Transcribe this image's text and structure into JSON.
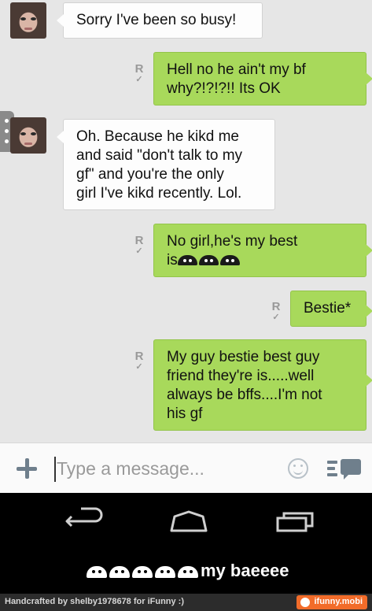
{
  "conversation": {
    "messages": [
      {
        "direction": "incoming",
        "text": "Sorry I've been so busy!"
      },
      {
        "direction": "outgoing",
        "read_mark": "R",
        "lines": [
          "Hell no he ain't my bf",
          "why?!?!?!! Its OK"
        ]
      },
      {
        "direction": "incoming",
        "lines": [
          "Oh. Because he kikd me",
          "and said \"don't talk to my",
          "gf\" and you're the only",
          "girl I've kikd recently. Lol."
        ]
      },
      {
        "direction": "outgoing",
        "read_mark": "R",
        "lines": [
          "No girl,he's my best",
          "is"
        ],
        "emoji": [
          "android-emoji",
          "android-emoji",
          "android-emoji"
        ]
      },
      {
        "direction": "outgoing",
        "read_mark": "R",
        "text": "Bestie*"
      },
      {
        "direction": "outgoing",
        "read_mark": "R",
        "lines": [
          "My guy bestie best guy",
          "friend they're is.....well",
          "always be bffs....I'm not",
          "his gf"
        ]
      }
    ]
  },
  "composer": {
    "placeholder": "Type a message...",
    "add_icon": "plus-icon",
    "emoji_icon": "smiley-icon",
    "send_icon": "send-icon"
  },
  "navigation": {
    "buttons": [
      "back-icon",
      "home-icon",
      "recents-icon"
    ]
  },
  "caption": {
    "emoji_count": 5,
    "text": "my baeeee"
  },
  "footer": {
    "credit": "Handcrafted by shelby1978678 for iFunny :)",
    "brand": "ifunny.mobi"
  },
  "colors": {
    "chat_background": "#e6e6e6",
    "incoming_bubble": "#fdfdfd",
    "outgoing_bubble": "#a8d95b",
    "icon_gray": "#6f7f8c",
    "brand_orange": "#f26c2a"
  }
}
